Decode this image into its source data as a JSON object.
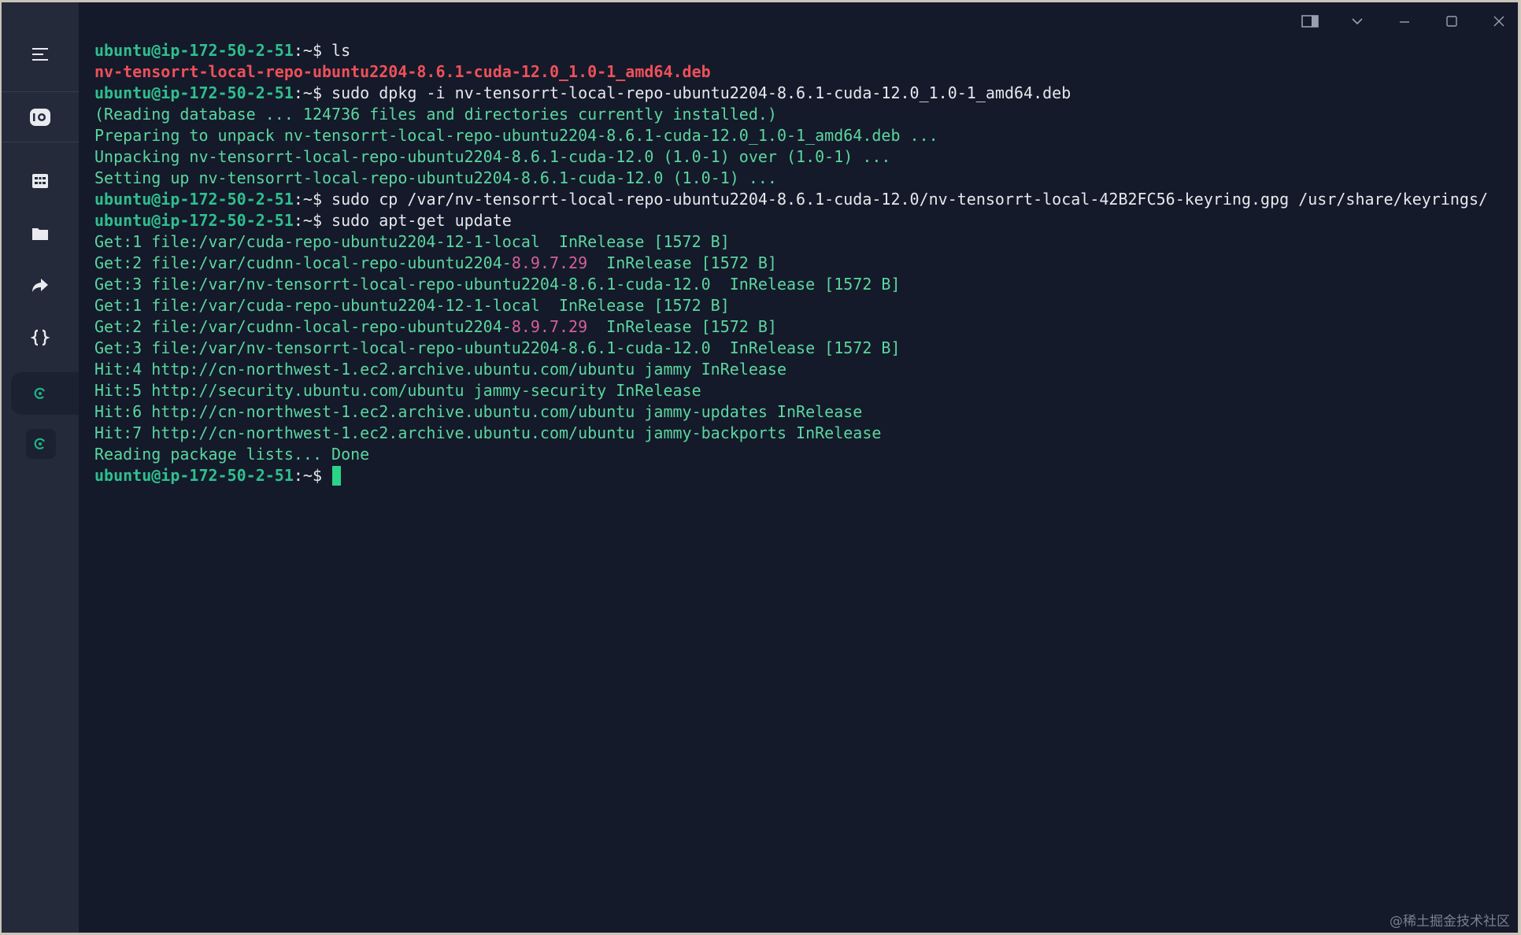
{
  "titlebar": {
    "controls": [
      "split-pane-icon",
      "dropdown-icon",
      "minimize-icon",
      "maximize-icon",
      "close-icon"
    ]
  },
  "sidebar": {
    "items": [
      {
        "name": "menu-icon"
      },
      {
        "name": "connection-icon"
      },
      {
        "name": "dashboard-icon"
      },
      {
        "name": "folder-icon"
      },
      {
        "name": "forward-icon"
      },
      {
        "name": "code-icon"
      },
      {
        "name": "session-icon"
      },
      {
        "name": "session-2-icon"
      }
    ]
  },
  "terminal": {
    "prompt_user": "ubuntu@ip-172-50-2-51",
    "prompt_sym": ":~$",
    "lines": [
      {
        "t": "prompt",
        "cmd": " ls"
      },
      {
        "t": "redbold",
        "text": "nv-tensorrt-local-repo-ubuntu2204-8.6.1-cuda-12.0_1.0-1_amd64.deb"
      },
      {
        "t": "prompt",
        "cmd": " sudo dpkg -i nv-tensorrt-local-repo-ubuntu2204-8.6.1-cuda-12.0_1.0-1_amd64.deb"
      },
      {
        "t": "out",
        "text": "(Reading database ... 124736 files and directories currently installed.)"
      },
      {
        "t": "out",
        "text": "Preparing to unpack nv-tensorrt-local-repo-ubuntu2204-8.6.1-cuda-12.0_1.0-1_amd64.deb ..."
      },
      {
        "t": "out",
        "text": "Unpacking nv-tensorrt-local-repo-ubuntu2204-8.6.1-cuda-12.0 (1.0-1) over (1.0-1) ..."
      },
      {
        "t": "out",
        "text": "Setting up nv-tensorrt-local-repo-ubuntu2204-8.6.1-cuda-12.0 (1.0-1) ..."
      },
      {
        "t": "prompt",
        "cmd": " sudo cp /var/nv-tensorrt-local-repo-ubuntu2204-8.6.1-cuda-12.0/nv-tensorrt-local-42B2FC56-keyring.gpg /usr/share/keyrings/"
      },
      {
        "t": "prompt",
        "cmd": " sudo apt-get update"
      },
      {
        "t": "out",
        "text": "Get:1 file:/var/cuda-repo-ubuntu2204-12-1-local  InRelease [1572 B]"
      },
      {
        "t": "split",
        "a": "Get:2 file:/var/cudnn-local-repo-ubuntu2204-",
        "b": "8.9.7.29",
        "c": "  InRelease [1572 B]"
      },
      {
        "t": "out",
        "text": "Get:3 file:/var/nv-tensorrt-local-repo-ubuntu2204-8.6.1-cuda-12.0  InRelease [1572 B]"
      },
      {
        "t": "out",
        "text": "Get:1 file:/var/cuda-repo-ubuntu2204-12-1-local  InRelease [1572 B]"
      },
      {
        "t": "split",
        "a": "Get:2 file:/var/cudnn-local-repo-ubuntu2204-",
        "b": "8.9.7.29",
        "c": "  InRelease [1572 B]"
      },
      {
        "t": "out",
        "text": "Get:3 file:/var/nv-tensorrt-local-repo-ubuntu2204-8.6.1-cuda-12.0  InRelease [1572 B]"
      },
      {
        "t": "out",
        "text": "Hit:4 http://cn-northwest-1.ec2.archive.ubuntu.com/ubuntu jammy InRelease"
      },
      {
        "t": "out",
        "text": "Hit:5 http://security.ubuntu.com/ubuntu jammy-security InRelease"
      },
      {
        "t": "out",
        "text": "Hit:6 http://cn-northwest-1.ec2.archive.ubuntu.com/ubuntu jammy-updates InRelease"
      },
      {
        "t": "out",
        "text": "Hit:7 http://cn-northwest-1.ec2.archive.ubuntu.com/ubuntu jammy-backports InRelease"
      },
      {
        "t": "out",
        "text": "Reading package lists... Done"
      },
      {
        "t": "prompt",
        "cmd": " ",
        "cursor": true
      }
    ]
  },
  "watermark": "@稀土掘金技术社区"
}
